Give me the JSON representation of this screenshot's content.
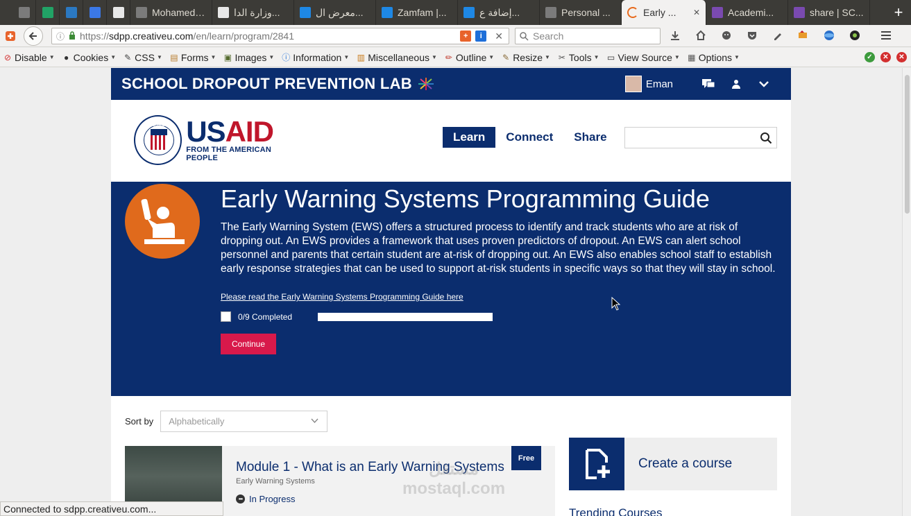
{
  "browser": {
    "tabs": [
      {
        "label": "",
        "icon": "gmail-icon",
        "color": "#7b7b7b",
        "pinned": true
      },
      {
        "label": "",
        "icon": "sheets-icon",
        "color": "#21a366",
        "pinned": true
      },
      {
        "label": "",
        "icon": "asterisk-icon",
        "color": "#2b79c2",
        "pinned": true
      },
      {
        "label": "",
        "icon": "docs-icon",
        "color": "#3b78e7",
        "pinned": true
      },
      {
        "label": "",
        "icon": "olx-icon",
        "color": "#e8e8e8",
        "pinned": true
      },
      {
        "label": "Mohamed El...",
        "icon": "gmail-icon",
        "color": "#7b7b7b",
        "pinned": false
      },
      {
        "label": "وزارة الدا...",
        "icon": "page-icon",
        "color": "#e8e8e8",
        "pinned": false
      },
      {
        "label": "معرض ال...",
        "icon": "mostaql-icon",
        "color": "#1e88e5",
        "pinned": false
      },
      {
        "label": "Zamfam |...",
        "icon": "mostaql-icon",
        "color": "#1e88e5",
        "pinned": false
      },
      {
        "label": "إضافة ع...",
        "icon": "mostaql-icon",
        "color": "#1e88e5",
        "pinned": false
      },
      {
        "label": "Personal ...",
        "icon": "gmail-icon",
        "color": "#7b7b7b",
        "pinned": false
      },
      {
        "label": "Early ...",
        "icon": "loading-icon",
        "color": "#e86a1c",
        "pinned": false,
        "active": true
      },
      {
        "label": "Academi...",
        "icon": "sdpp-icon",
        "color": "#7a4ab0",
        "pinned": false
      },
      {
        "label": "share | SC...",
        "icon": "sdpp-icon",
        "color": "#7a4ab0",
        "pinned": false
      }
    ],
    "new_tab": "+",
    "url_prefix": "https://",
    "url_host": "sdpp.creativeu.com",
    "url_path": "/en/learn/program/2841",
    "search_placeholder": "Search",
    "status_text": "Connected to sdpp.creativeu.com..."
  },
  "devbar": {
    "items": [
      {
        "label": "Disable",
        "icon": "disable-icon"
      },
      {
        "label": "Cookies",
        "icon": "cookies-icon"
      },
      {
        "label": "CSS",
        "icon": "css-icon"
      },
      {
        "label": "Forms",
        "icon": "forms-icon"
      },
      {
        "label": "Images",
        "icon": "images-icon"
      },
      {
        "label": "Information",
        "icon": "info-icon"
      },
      {
        "label": "Miscellaneous",
        "icon": "misc-icon"
      },
      {
        "label": "Outline",
        "icon": "outline-icon"
      },
      {
        "label": "Resize",
        "icon": "resize-icon"
      },
      {
        "label": "Tools",
        "icon": "tools-icon"
      },
      {
        "label": "View Source",
        "icon": "view-source-icon"
      },
      {
        "label": "Options",
        "icon": "options-icon"
      }
    ]
  },
  "site": {
    "brand": "SCHOOL DROPOUT PREVENTION LAB",
    "username": "Eman",
    "logo_main_us": "US",
    "logo_main_aid": "AID",
    "logo_tagline": "FROM THE AMERICAN PEOPLE",
    "logo_seal_text": "USAID",
    "nav": [
      "Learn",
      "Connect",
      "Share"
    ],
    "search_placeholder": ""
  },
  "hero": {
    "title": "Early Warning Systems Programming Guide",
    "description": "The Early Warning System (EWS) offers a structured process to identify and track students who are at risk of dropping out. An EWS provides a framework that uses proven predictors of dropout. An EWS can alert school personnel and parents that certain student are at-risk of dropping out. An EWS also enables school staff to establish early response strategies that can be used to support at-risk students in specific ways so that they will stay in school.",
    "link": "Please read the Early Warning Systems Programming Guide here",
    "progress_label": "0/9 Completed",
    "progress_fraction": 0,
    "continue": "Continue"
  },
  "sort": {
    "label": "Sort by",
    "selected": "Alphabetically"
  },
  "module": {
    "title": "Module 1 - What is an Early Warning Systems",
    "subtitle": "Early Warning Systems",
    "status": "In Progress",
    "badge": "Free",
    "watermark_ar": "مستقل",
    "watermark_en": "mostaql.com"
  },
  "sidebar": {
    "create_label": "Create a course",
    "trending": "Trending Courses"
  },
  "colors": {
    "brand_navy": "#0b2d6e",
    "accent_red": "#d8194b",
    "badge_orange": "#e06a1c",
    "usaid_red": "#c0162b"
  }
}
